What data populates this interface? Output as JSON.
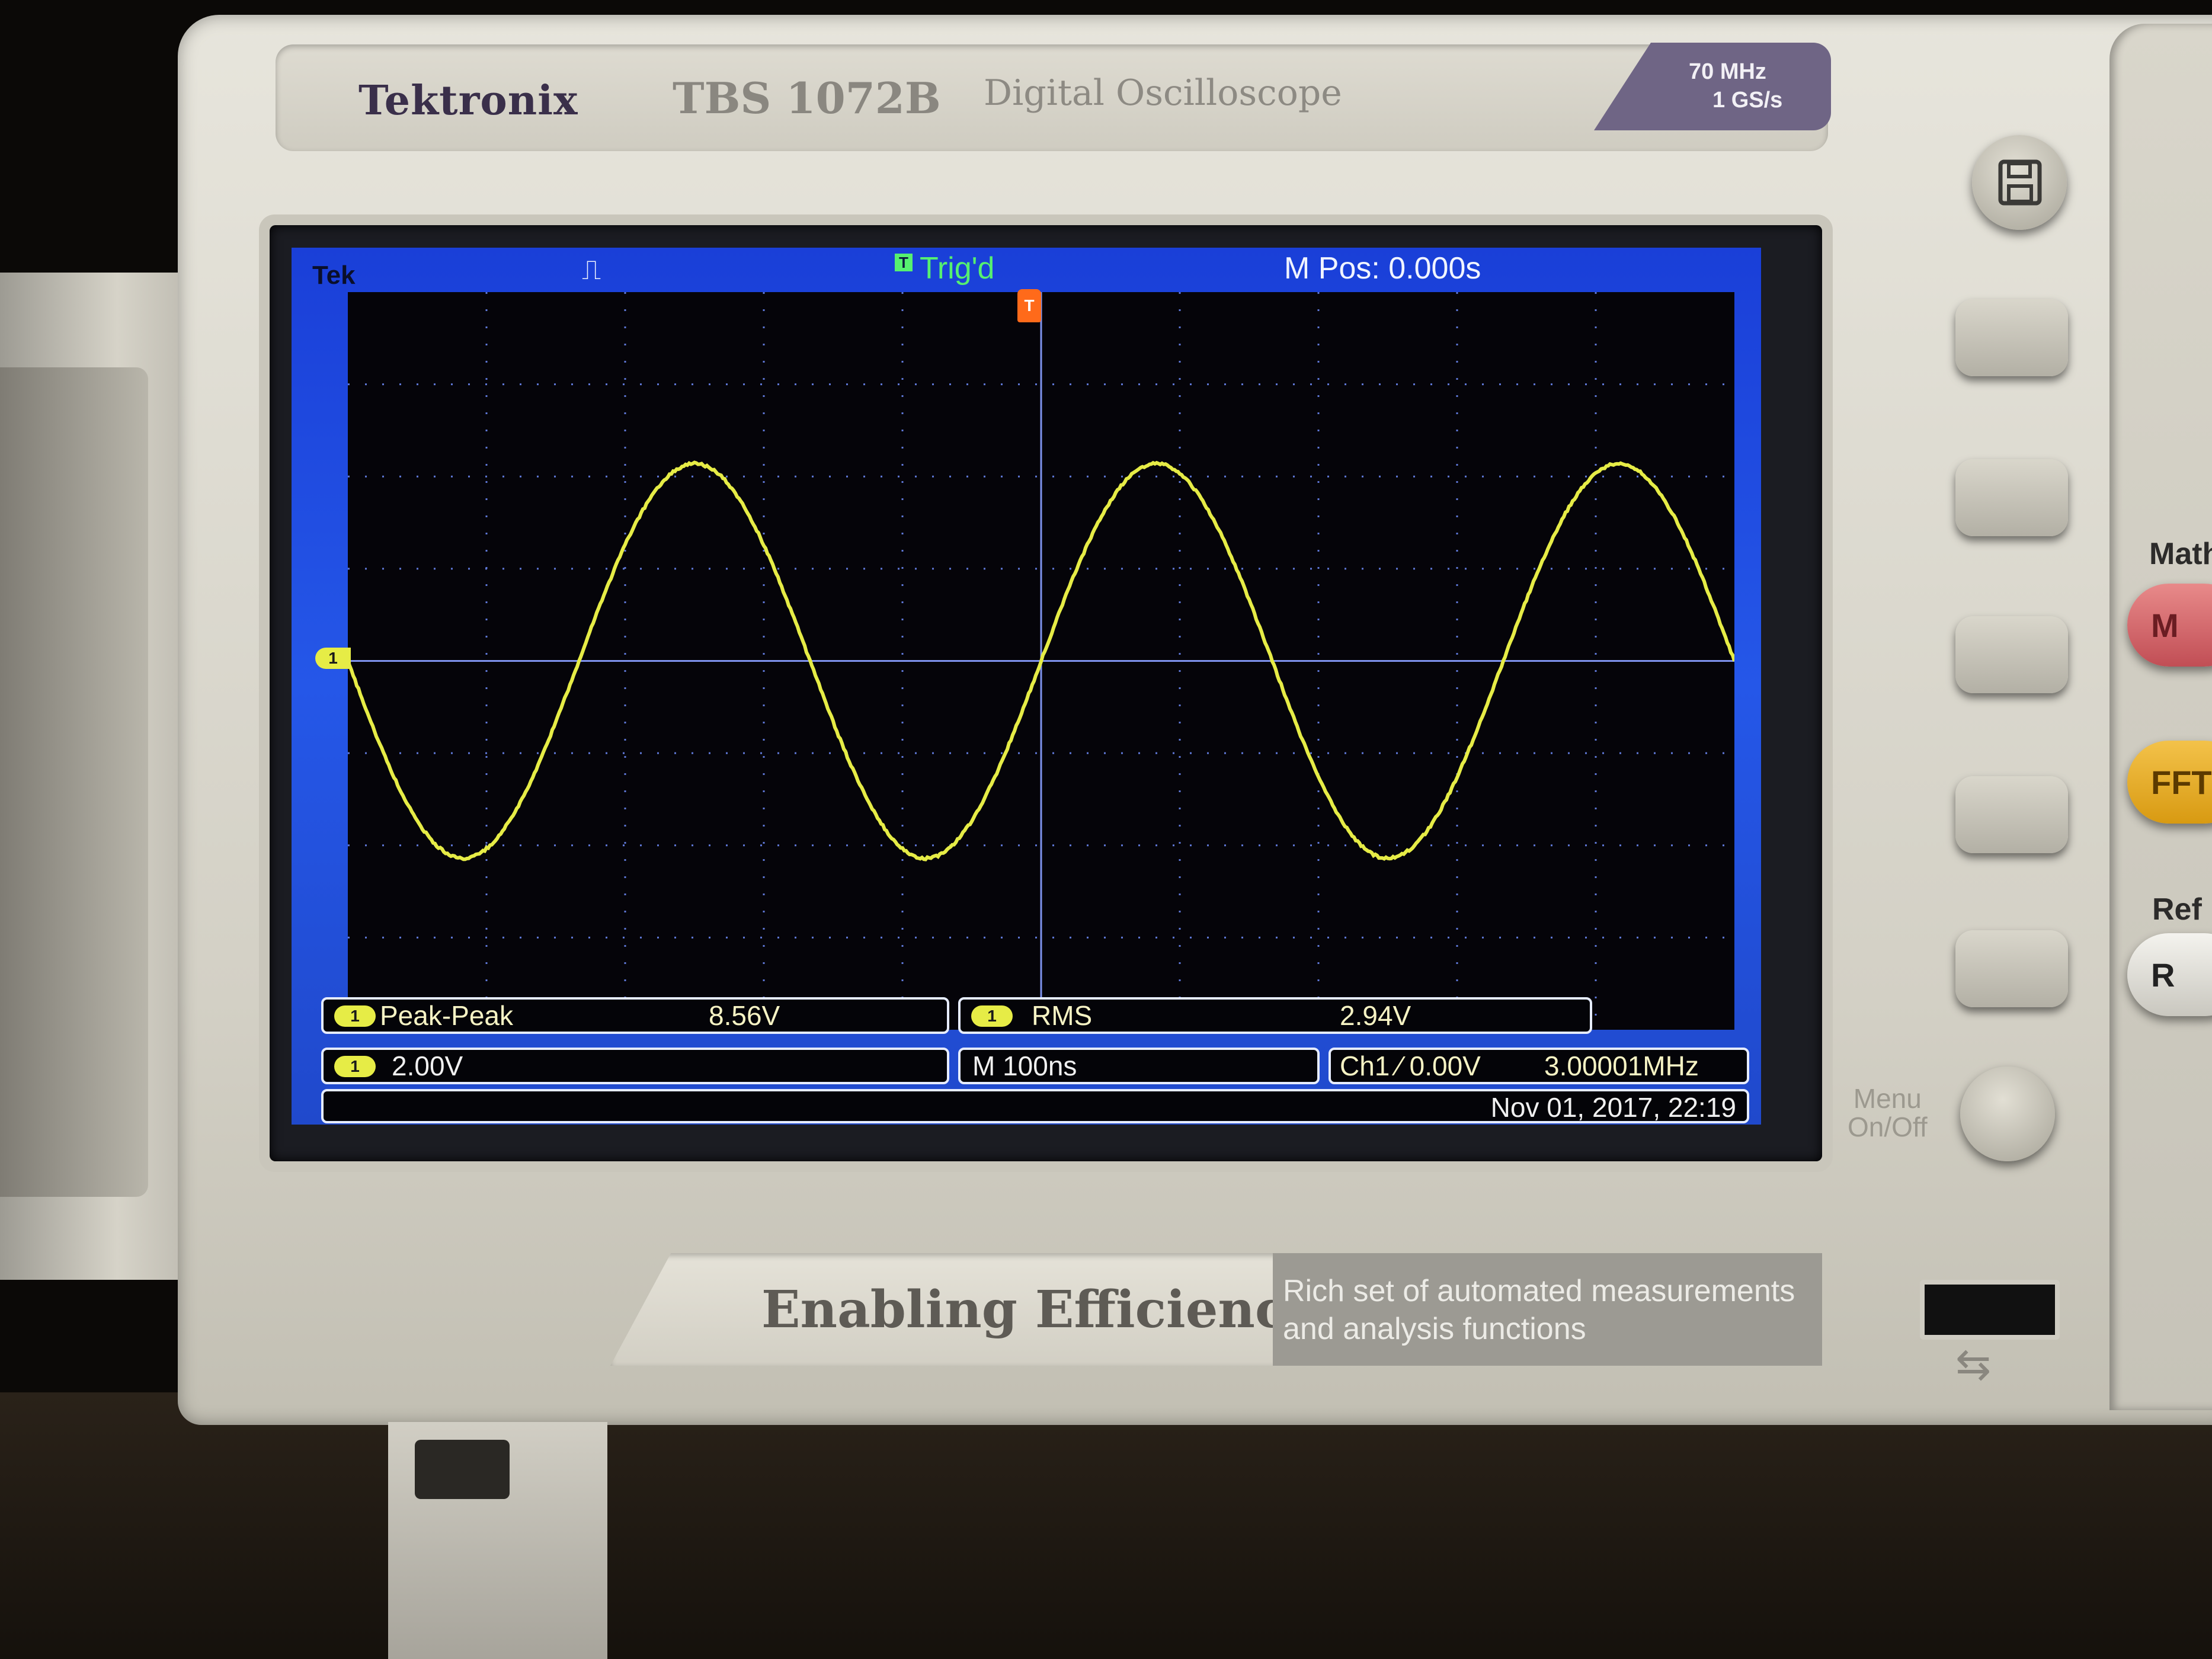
{
  "device": {
    "brand": "Tektronix",
    "model": "TBS 1072B",
    "description": "Digital Oscilloscope",
    "spec_bandwidth": "70 MHz",
    "spec_sample_rate": "1 GS/s",
    "slogan": "Enabling Efficiency",
    "slogan_desc_line1": "Rich set of automated measurements",
    "slogan_desc_line2": "and analysis functions",
    "menu_label_line1": "Menu",
    "menu_label_line2": "On/Off",
    "usb_icon": "⇆",
    "side_panel": {
      "math_label": "Math",
      "math_button": "M",
      "fft_button": "FFT",
      "ref_label": "Ref",
      "ref_button": "R"
    }
  },
  "screen": {
    "brand_label": "Tek",
    "acq_icon": "⎍",
    "trigger_mark": "T",
    "trigger_status": "Trig'd",
    "main_position": "M Pos: 0.000s",
    "channel_marker": "1",
    "trigger_position_marker": "T",
    "measurements": [
      {
        "channel": "1",
        "name": "Peak-Peak",
        "value": "8.56V"
      },
      {
        "channel": "1",
        "name": "RMS",
        "value": "2.94V"
      }
    ],
    "channel_scale": {
      "channel": "1",
      "value": "2.00V"
    },
    "timebase": "M 100ns",
    "trigger_info": "Ch1 ⁄ 0.00V",
    "frequency": "3.00001MHz",
    "datetime": "Nov 01, 2017, 22:19"
  },
  "chart_data": {
    "type": "line",
    "grid": true,
    "x_divisions": 10,
    "y_divisions": 8,
    "series": [
      {
        "channel": "1",
        "shape": "sine",
        "frequency_hz": 3000010,
        "peak_to_peak_v": 8.56,
        "color": "#e6ec46"
      }
    ],
    "colors": {
      "trace": "#e6ec46",
      "grid": "#5f78d8",
      "background": "#050409",
      "frame": "#2557e8"
    }
  }
}
